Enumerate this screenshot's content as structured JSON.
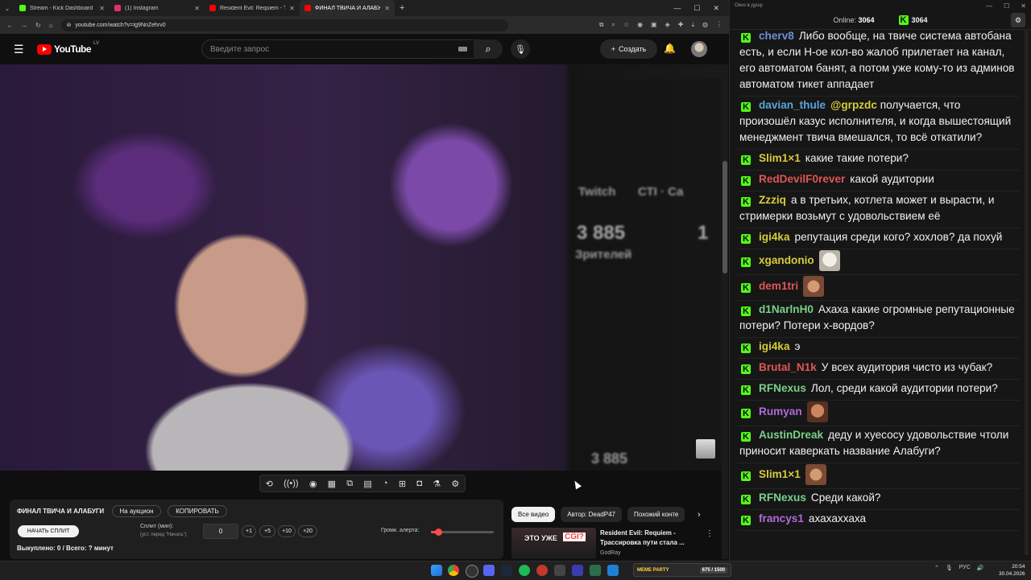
{
  "browser": {
    "tabs": [
      {
        "title": "Stream - Kick Dashboard",
        "color": "#53fc18"
      },
      {
        "title": "(1) Instagram",
        "color": "#e1306c"
      },
      {
        "title": "Resident Evil: Requiem - Трассир…",
        "color": "#ff0000"
      },
      {
        "title": "ФИНАЛ ТВИЧА И АЛАБУГИ…",
        "color": "#ff0000"
      }
    ],
    "url": "youtube.com/watch?v=Ig9NnZehrv0"
  },
  "youtube": {
    "logo_text": "YouTube",
    "country": "LV",
    "search_placeholder": "Введите запрос",
    "create_label": "Создать"
  },
  "video_overlay": {
    "twitch": "Twitch",
    "cti": "СТI · Са",
    "views": "3 885",
    "views_label": "Зрителей",
    "views_right": "1",
    "bottom": "3 885"
  },
  "panel": {
    "title": "ФИНАЛ ТВИЧА И АЛАБУГИ",
    "auction_label": "На аукцион",
    "copy_label": "КОПИРОВАТЬ",
    "start_label": "НАЧАТЬ СПЛИТ",
    "split_label": "Сплит (мин):",
    "split_hint": "(уст. перед \"Начать\")",
    "split_value": "0",
    "increments": [
      "+1",
      "+5",
      "+10",
      "+20"
    ],
    "alert_label": "Громк. алерта:",
    "alert_volume": 0.12,
    "bought_text": "Выкуплено: 0 / Всего: ? минут"
  },
  "recommendations": {
    "chips": [
      "Все видео",
      "Автор: DeadP47",
      "Похожий конте"
    ],
    "video": {
      "thumb_text": "ЭТО УЖЕ",
      "thumb_badge": "CGI?",
      "title": "Resident Evil: Requiem - Трассировка пути стала ...",
      "channel": "GodRay"
    }
  },
  "chat": {
    "window_title": "Окно в душу",
    "online_label": "Online:",
    "online_count": "3064",
    "kick_count": "3064",
    "messages": [
      {
        "user": "cherv8",
        "color": "#6e8fd6",
        "text": "Либо вообще, на твиче система автобана есть, и если Н-ое кол-во жалоб прилетает на канал, его автоматом банят, а потом уже кому-то из админов автоматом тикет аппадает"
      },
      {
        "user": "davian_thule",
        "color": "#5aa3d8",
        "mention": "@grpzdc",
        "text": "получается, что произошёл казус исполнителя, и когда вышестоящий менеджмент твича вмешался, то всё откатили?"
      },
      {
        "user": "Slim1×1",
        "color": "#d7cc3a",
        "text": "какие такие потери?"
      },
      {
        "user": "RedDevilF0rever",
        "color": "#e05555",
        "text": "какой аудитории"
      },
      {
        "user": "Zzziq",
        "color": "#d7cc3a",
        "text": "а в третьих, котлета может и вырасти, и стримерки возьмут с удовольствием её"
      },
      {
        "user": "igi4ka",
        "color": "#d7cc3a",
        "text": "репутация среди кого? хохлов? да похуй"
      },
      {
        "user": "xgandonio",
        "color": "#d7cc3a",
        "emote": "cat",
        "text": ""
      },
      {
        "user": "dem1tri",
        "color": "#e05555",
        "emote": "face",
        "text": ""
      },
      {
        "user": "d1NarlnH0",
        "color": "#7ad08a",
        "text": "Ахаха какие огромные репутационные потери? Потери х-вордов?"
      },
      {
        "user": "igi4ka",
        "color": "#d7cc3a",
        "text": "э"
      },
      {
        "user": "Brutal_N1k",
        "color": "#e05555",
        "text": "У всех аудитория чисто из чубак?"
      },
      {
        "user": "RFNexus",
        "color": "#7ad08a",
        "text": "Лол, среди какой аудитории потери?"
      },
      {
        "user": "Rumyan",
        "color": "#b06ad8",
        "emote": "face2",
        "text": ""
      },
      {
        "user": "AustinDreak",
        "color": "#7ad08a",
        "text": "деду и хуесосу удовольствие чтоли приносит каверкать название Алабуги?"
      },
      {
        "user": "Slim1×1",
        "color": "#d7cc3a",
        "emote": "face",
        "text": ""
      },
      {
        "user": "RFNexus",
        "color": "#7ad08a",
        "text": "Среди какой?"
      },
      {
        "user": "francys1",
        "color": "#b06ad8",
        "text": "ахахаххаха"
      }
    ]
  },
  "taskbar": {
    "meme_label": "MEME PARTY",
    "meme_count": "675 / 1500",
    "lang": "РУС",
    "time": "20:54",
    "date": "30.04.2026"
  }
}
